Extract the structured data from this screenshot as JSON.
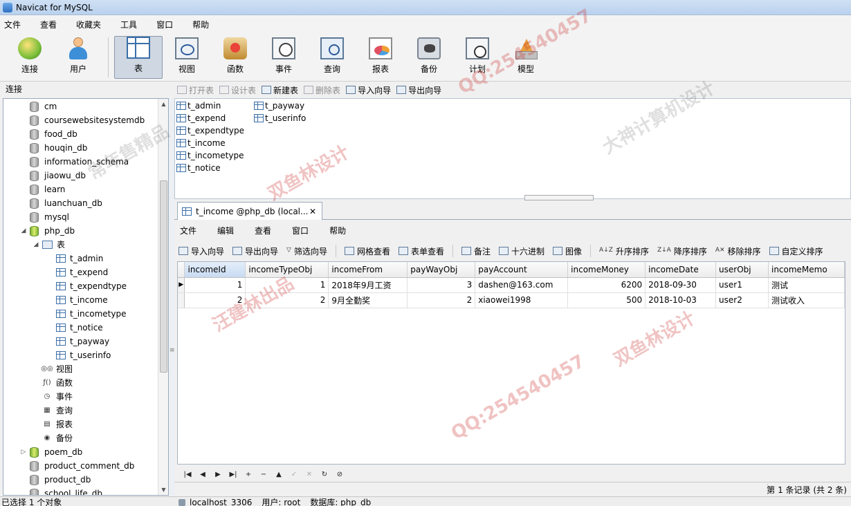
{
  "window": {
    "title": "Navicat for MySQL"
  },
  "menubar": [
    "文件",
    "查看",
    "收藏夹",
    "工具",
    "窗口",
    "帮助"
  ],
  "toolbar": [
    {
      "label": "连接",
      "icon": "connection-icon"
    },
    {
      "label": "用户",
      "icon": "user-icon"
    },
    {
      "label": "表",
      "icon": "table-icon",
      "active": true
    },
    {
      "label": "视图",
      "icon": "view-icon"
    },
    {
      "label": "函数",
      "icon": "function-icon"
    },
    {
      "label": "事件",
      "icon": "event-icon"
    },
    {
      "label": "查询",
      "icon": "query-icon"
    },
    {
      "label": "报表",
      "icon": "report-icon"
    },
    {
      "label": "备份",
      "icon": "backup-icon"
    },
    {
      "label": "计划",
      "icon": "schedule-icon"
    },
    {
      "label": "模型",
      "icon": "model-icon"
    }
  ],
  "sidebar": {
    "header": "连接",
    "databases_top": [
      "cm",
      "coursewebsitesystemdb",
      "food_db",
      "houqin_db",
      "information_schema",
      "jiaowu_db",
      "learn",
      "luanchuan_db",
      "mysql"
    ],
    "open_db": "php_db",
    "tables_folder": "表",
    "tables": [
      "t_admin",
      "t_expend",
      "t_expendtype",
      "t_income",
      "t_incometype",
      "t_notice",
      "t_payway",
      "t_userinfo"
    ],
    "other_nodes": [
      {
        "label": "视图",
        "icon": "view-icon",
        "glyph": "◎◎"
      },
      {
        "label": "函数",
        "icon": "function-icon",
        "glyph": "ƒ()"
      },
      {
        "label": "事件",
        "icon": "event-icon",
        "glyph": "◷"
      },
      {
        "label": "查询",
        "icon": "query-icon",
        "glyph": "▦"
      },
      {
        "label": "报表",
        "icon": "report-icon",
        "glyph": "▤"
      },
      {
        "label": "备份",
        "icon": "backup-icon",
        "glyph": "◉"
      }
    ],
    "poem_db": "poem_db",
    "databases_bottom": [
      "product_comment_db",
      "product_db",
      "school_life_db"
    ]
  },
  "objbar": [
    {
      "label": "打开表",
      "disabled": true
    },
    {
      "label": "设计表",
      "disabled": true
    },
    {
      "label": "新建表",
      "disabled": false
    },
    {
      "label": "删除表",
      "disabled": true
    },
    {
      "label": "导入向导",
      "disabled": false
    },
    {
      "label": "导出向导",
      "disabled": false
    }
  ],
  "objlist": {
    "col1": [
      "t_admin",
      "t_expend",
      "t_expendtype",
      "t_income",
      "t_incometype",
      "t_notice"
    ],
    "col2": [
      "t_payway",
      "t_userinfo"
    ]
  },
  "tab": {
    "label": "t_income @php_db (local...",
    "close": "✕"
  },
  "table_menu": [
    "文件",
    "编辑",
    "查看",
    "窗口",
    "帮助"
  ],
  "table_tools": {
    "group1": [
      "导入向导",
      "导出向导",
      "筛选向导"
    ],
    "group2": [
      "网格查看",
      "表单查看"
    ],
    "group3": [
      "备注",
      "十六进制",
      "图像"
    ],
    "group4": [
      "升序排序",
      "降序排序",
      "移除排序",
      "自定义排序"
    ]
  },
  "grid": {
    "columns": [
      "incomeId",
      "incomeTypeObj",
      "incomeFrom",
      "payWayObj",
      "payAccount",
      "incomeMoney",
      "incomeDate",
      "userObj",
      "incomeMemo"
    ],
    "rows": [
      [
        "1",
        "1",
        "2018年9月工资",
        "3",
        "dashen@163.com",
        "6200",
        "2018-09-30",
        "user1",
        "测试"
      ],
      [
        "2",
        "2",
        "9月全勤奖",
        "2",
        "xiaowei1998",
        "500",
        "2018-10-03",
        "user2",
        "测试收入"
      ]
    ]
  },
  "nav": [
    "|◀",
    "◀",
    "▶",
    "▶|",
    "+",
    "−",
    "▲",
    "✓",
    "✕",
    "↻",
    "⊘"
  ],
  "record_count": "第 1 条记录 (共 2 条)",
  "status": {
    "selection": "已选择 1 个对象",
    "host": "localhost_3306",
    "user": "用户: root",
    "database": "数据库: php_db"
  },
  "watermarks": [
    "QQ:254540457",
    "双鱼林设计",
    "汪建林出品",
    "大神计算机设计",
    "常年售精品"
  ]
}
